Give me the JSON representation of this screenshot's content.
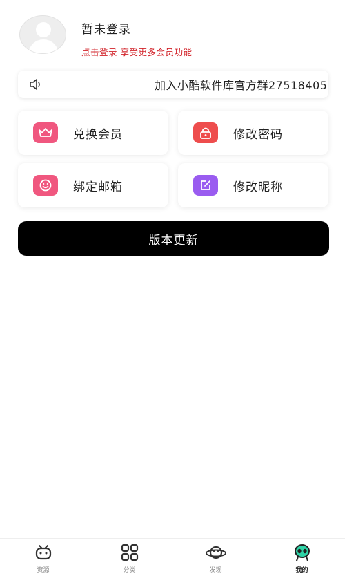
{
  "profile": {
    "status": "暂未登录",
    "hint": "点击登录 享受更多会员功能"
  },
  "notice": {
    "icon": "speaker-icon",
    "text": "加入小酷软件库官方群27518405"
  },
  "cards": [
    {
      "label": "兑换会员",
      "icon": "crown-icon",
      "color": "#f0577f"
    },
    {
      "label": "修改密码",
      "icon": "lock-icon",
      "color": "#ee4d4d"
    },
    {
      "label": "绑定邮箱",
      "icon": "smile-icon",
      "color": "#f0577f"
    },
    {
      "label": "修改昵称",
      "icon": "edit-icon",
      "color": "#9a5cf0"
    }
  ],
  "update_button": {
    "label": "版本更新"
  },
  "tabbar": {
    "active": 3,
    "tabs": [
      {
        "label": "资源",
        "icon": "robot-icon"
      },
      {
        "label": "分类",
        "icon": "grid-icon"
      },
      {
        "label": "发现",
        "icon": "planet-icon"
      },
      {
        "label": "我的",
        "icon": "alien-icon"
      }
    ]
  },
  "colors": {
    "hint_red": "#d2232a",
    "button_bg": "#000000",
    "active_tab_accent": "#2fd3a6"
  }
}
